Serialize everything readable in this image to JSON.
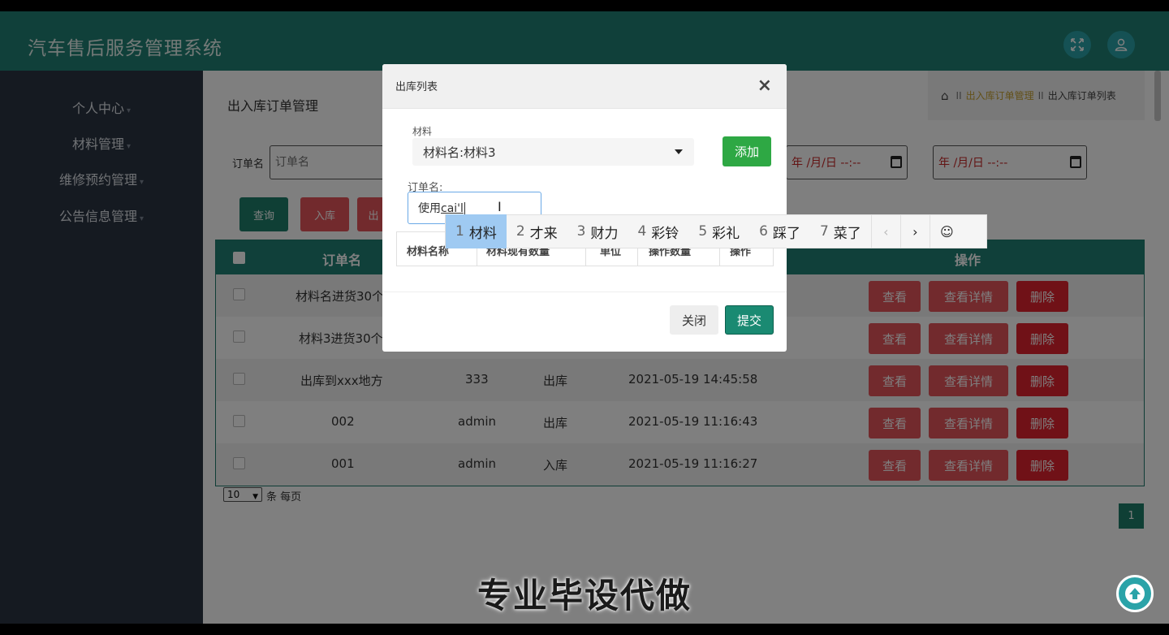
{
  "app": {
    "title": "汽车售后服务管理系统"
  },
  "sidebar": {
    "items": [
      {
        "label": "个人中心"
      },
      {
        "label": "材料管理"
      },
      {
        "label": "维修预约管理"
      },
      {
        "label": "公告信息管理"
      }
    ]
  },
  "page": {
    "title": "出入库订单管理"
  },
  "breadcrumb": {
    "link": "出入库订单管理",
    "current": "出入库订单列表",
    "separator": "II"
  },
  "filters": {
    "order_label": "订单名",
    "order_placeholder": "订单名",
    "date_placeholder": "年 /月/日 --:--"
  },
  "actions": {
    "query": "查询",
    "in": "入库",
    "out": "出"
  },
  "table": {
    "headers": {
      "name": "订单名",
      "ops": "操作"
    },
    "rows": [
      {
        "name": "材料名进货30个",
        "user": "",
        "type": "",
        "time": ""
      },
      {
        "name": "材料3进货30个",
        "user": "",
        "type": "",
        "time": ""
      },
      {
        "name": "出库到xxx地方",
        "user": "333",
        "type": "出库",
        "time": "2021-05-19 14:45:58"
      },
      {
        "name": "002",
        "user": "admin",
        "type": "出库",
        "time": "2021-05-19 11:16:43"
      },
      {
        "name": "001",
        "user": "admin",
        "type": "入库",
        "time": "2021-05-19 11:16:27"
      }
    ],
    "op_labels": {
      "view": "查看",
      "detail": "查看详情",
      "delete": "删除"
    }
  },
  "pager": {
    "page_size": "10",
    "per_page_label": "条 每页",
    "current_page": "1"
  },
  "modal": {
    "title": "出库列表",
    "material_label": "材料",
    "material_value": "材料名:材料3",
    "add_label": "添加",
    "order_label": "订单名:",
    "order_value_prefix": "使用",
    "order_value_ime": "cai'l",
    "table_headers": [
      "材料名称",
      "材料现有数量",
      "单位",
      "操作数量",
      "操作"
    ],
    "close_label": "关闭",
    "submit_label": "提交"
  },
  "ime": {
    "candidates": [
      {
        "num": "1",
        "text": "材料"
      },
      {
        "num": "2",
        "text": "才来"
      },
      {
        "num": "3",
        "text": "财力"
      },
      {
        "num": "4",
        "text": "彩铃"
      },
      {
        "num": "5",
        "text": "彩礼"
      },
      {
        "num": "6",
        "text": "踩了"
      },
      {
        "num": "7",
        "text": "菜了"
      }
    ],
    "prev": "‹",
    "next": "›",
    "emoji": "☺"
  },
  "caption": "专业毕设代做",
  "colors": {
    "header": "#218175",
    "sidebar": "#2b3442",
    "danger": "#e4545b",
    "success": "#2ea844"
  }
}
